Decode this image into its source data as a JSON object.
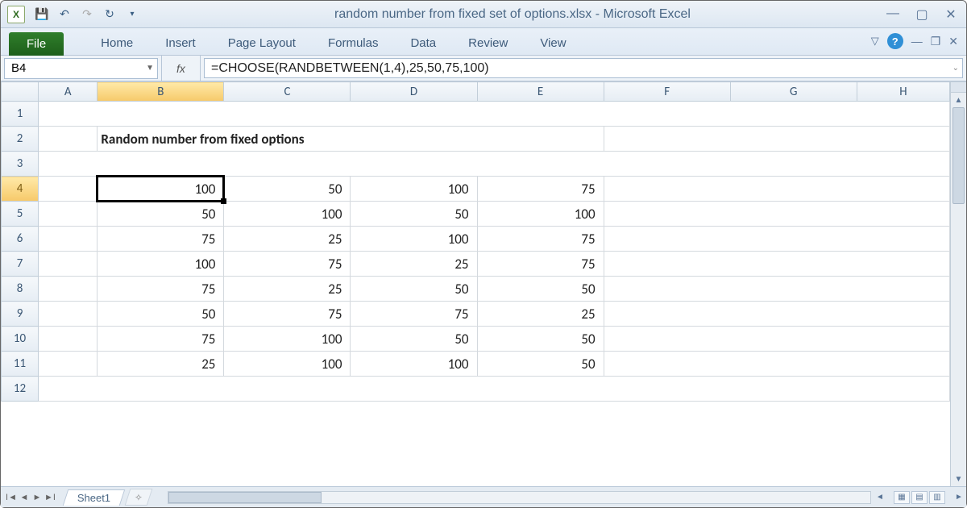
{
  "window": {
    "title": "random number from fixed set of options.xlsx  -  Microsoft Excel"
  },
  "ribbon": {
    "file": "File",
    "tabs": [
      "Home",
      "Insert",
      "Page Layout",
      "Formulas",
      "Data",
      "Review",
      "View"
    ]
  },
  "namebox": "B4",
  "formula": "=CHOOSE(RANDBETWEEN(1,4),25,50,75,100)",
  "columns": [
    "A",
    "B",
    "C",
    "D",
    "E",
    "F",
    "G",
    "H"
  ],
  "rows": [
    "1",
    "2",
    "3",
    "4",
    "5",
    "6",
    "7",
    "8",
    "9",
    "10",
    "11",
    "12"
  ],
  "sheet_title": "Random number from fixed options",
  "grid": [
    [
      100,
      50,
      100,
      75
    ],
    [
      50,
      100,
      50,
      100
    ],
    [
      75,
      25,
      100,
      75
    ],
    [
      100,
      75,
      25,
      75
    ],
    [
      75,
      25,
      50,
      50
    ],
    [
      50,
      75,
      75,
      25
    ],
    [
      75,
      100,
      50,
      50
    ],
    [
      25,
      100,
      100,
      50
    ]
  ],
  "sheet_tab": "Sheet1",
  "selected": {
    "col": "B",
    "row": "4"
  },
  "colors": {
    "accent": "#1e5f1a",
    "header": "#e6edf4"
  }
}
